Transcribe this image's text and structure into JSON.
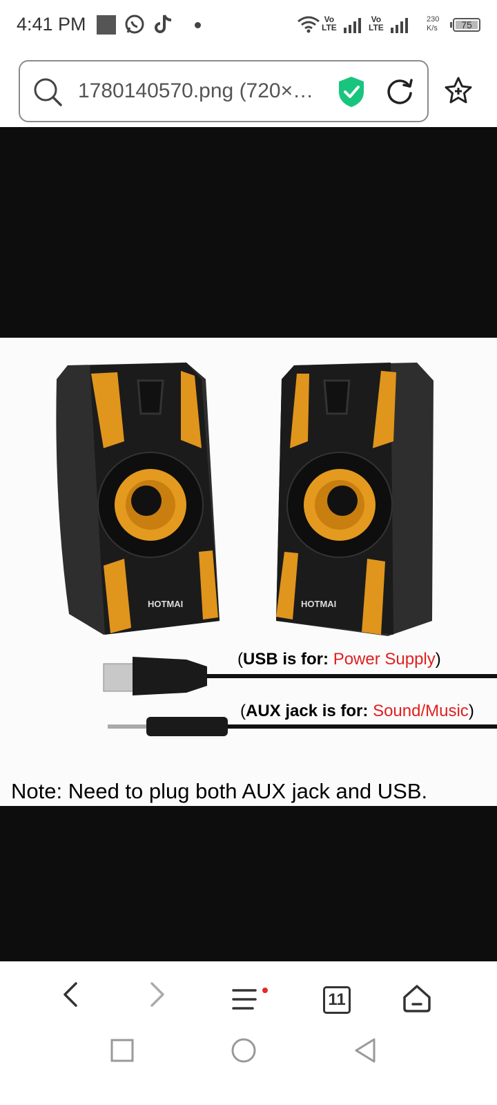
{
  "status_bar": {
    "time": "4:41 PM",
    "icons": [
      "gallery-icon",
      "whatsapp-icon",
      "tiktok-icon",
      "dot-icon",
      "wifi-icon",
      "volte-signal-icon",
      "volte-signal-icon",
      "battery-icon"
    ],
    "volte_1": "Vo\nLTE",
    "volte_2": "Vo\nLTE",
    "net_speed_value": "230",
    "net_speed_unit": "K/s",
    "battery": "75"
  },
  "address_bar": {
    "url_text": "1780140570.png (720×…",
    "search_icon": "search-icon",
    "secure_icon": "shield-check-icon",
    "reload_icon": "reload-icon",
    "bookmark_icon": "star-plus-icon",
    "accent_color": "#19c57e"
  },
  "image": {
    "caption_usb_prefix": "(",
    "caption_usb_bold": "USB is for:",
    "caption_usb_red": "Power Supply",
    "caption_usb_suffix": ")",
    "caption_aux_prefix": "(",
    "caption_aux_bold": "AUX jack is for:",
    "caption_aux_red": "Sound/Music",
    "caption_aux_suffix": ")",
    "note": "Note: Need to plug both AUX jack and USB.",
    "brand": "HOTMAI"
  },
  "toolbar": {
    "tabs_count": "11",
    "items": [
      "back-icon",
      "forward-icon",
      "menu-icon",
      "tabs-icon",
      "home-icon"
    ]
  },
  "nav": {
    "items": [
      "recents-icon",
      "home-circle-icon",
      "back-triangle-icon"
    ]
  }
}
